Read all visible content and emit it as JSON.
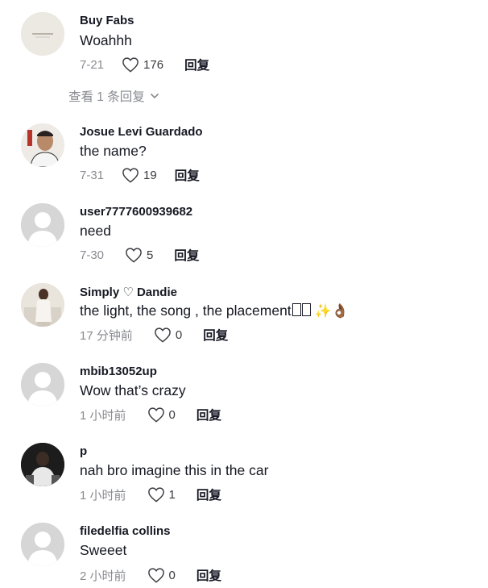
{
  "comments": [
    {
      "username": "Buy Fabs",
      "text": "Woahhh",
      "date": "7-21",
      "likes": "176",
      "reply": "回复",
      "avatar": "Buy Fabs logo"
    },
    {
      "username": "Josue Levi Guardado",
      "text": "the name?",
      "date": "7-31",
      "likes": "19",
      "reply": "回复"
    },
    {
      "username": "user7777600939682",
      "text": "need",
      "date": "7-30",
      "likes": "5",
      "reply": "回复"
    },
    {
      "username": "Simply ♡ Dandie",
      "text": "the light, the song , the placement",
      "emojis": "✨👌🏾",
      "date": "17 分钟前",
      "likes": "0",
      "reply": "回复"
    },
    {
      "username": "mbib13052up",
      "text": "Wow that’s crazy",
      "date": "1 小时前",
      "likes": "0",
      "reply": "回复"
    },
    {
      "username": "p",
      "text": "nah bro imagine this in the car",
      "date": "1 小时前",
      "likes": "1",
      "reply": "回复"
    },
    {
      "username": "filedelfia collins",
      "text": "Sweeet",
      "date": "2 小时前",
      "likes": "0",
      "reply": "回复"
    }
  ],
  "view_replies": "查看 1 条回复",
  "icons": {
    "like": "heart-outline-icon",
    "expand": "chevron-down-icon"
  },
  "colors": {
    "text": "#161823",
    "muted": "#8a8b91",
    "avatar_placeholder": "#d6d6d6"
  }
}
